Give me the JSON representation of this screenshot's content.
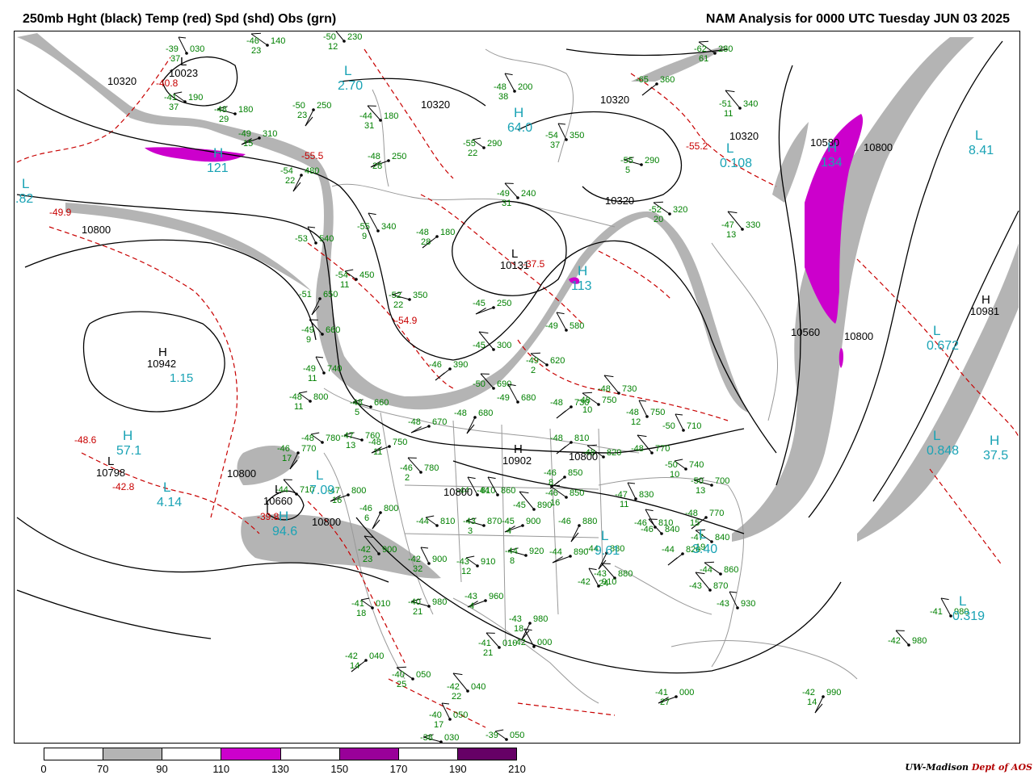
{
  "header": {
    "title_left": "250mb Hght (black) Temp (red) Spd (shd) Obs (grn)",
    "title_right": "NAM Analysis for 0000 UTC Tuesday  JUN 03 2025"
  },
  "legend": {
    "ticks": [
      "0",
      "70",
      "90",
      "110",
      "130",
      "150",
      "170",
      "190",
      "210"
    ],
    "bins": [
      {
        "range": "0-70",
        "color": "#ffffff"
      },
      {
        "range": "70-90",
        "color": "#b4b4b4"
      },
      {
        "range": "90-110",
        "color": "#ffffff"
      },
      {
        "range": "110-130",
        "color": "#cc00cc"
      },
      {
        "range": "130-150",
        "color": "#ffffff"
      },
      {
        "range": "150-170",
        "color": "#990099"
      },
      {
        "range": "170-190",
        "color": "#ffffff"
      },
      {
        "range": "190-210",
        "color": "#660066"
      }
    ]
  },
  "credit": {
    "org": "UW-Madison",
    "dept": "Dept of AOS"
  },
  "colors": {
    "height_contours": "#000000",
    "temperature_contours": "#c80000",
    "speed_shading_70_90": "#b4b4b4",
    "speed_shading_110_130": "#cc00cc",
    "observations": "#008000",
    "pressure_centers": "#1aa3b5",
    "borders": "#999999"
  },
  "height_centers": [
    {
      "type": "H",
      "value": "10942",
      "speed": "1.15"
    },
    {
      "type": "L",
      "value": "10131",
      "speed": ""
    },
    {
      "type": "H",
      "value": "10902",
      "speed": ""
    },
    {
      "type": "H",
      "value": "10981",
      "speed": ""
    },
    {
      "type": "L",
      "value": "10660",
      "speed": ""
    },
    {
      "type": "L",
      "value": "10798",
      "speed": ""
    },
    {
      "type": "L",
      "value": "10023",
      "speed": ""
    }
  ],
  "contour_labels": [
    "10320",
    "10320",
    "10320",
    "10320",
    "10320",
    "10800",
    "10800",
    "10800",
    "10800",
    "10800",
    "10800",
    "10560",
    "10580",
    "10800"
  ],
  "temperature_labels": [
    "-49.9",
    "-55.5",
    "-54.9",
    "-48.6",
    "-42.8",
    "-39.8",
    "-37.5",
    "-55.2",
    "-40.8"
  ],
  "speed_labels": [
    {
      "type": "L",
      "value": ".82"
    },
    {
      "type": "H",
      "value": "121"
    },
    {
      "type": "H",
      "value": "57.1"
    },
    {
      "type": "L",
      "value": "4.14"
    },
    {
      "type": "H",
      "value": "94.6"
    },
    {
      "type": "L",
      "value": "7.09"
    },
    {
      "type": "H",
      "value": "64.0"
    },
    {
      "type": "L",
      "value": "2.70"
    },
    {
      "type": "H",
      "value": "113"
    },
    {
      "type": "L",
      "value": "0.108"
    },
    {
      "type": "H",
      "value": "134"
    },
    {
      "type": "L",
      "value": "8.41"
    },
    {
      "type": "L",
      "value": "0.672"
    },
    {
      "type": "L",
      "value": "0.848"
    },
    {
      "type": "H",
      "value": "37.5"
    },
    {
      "type": "L",
      "value": "3.40"
    },
    {
      "type": "L",
      "value": "0.319"
    },
    {
      "type": "L",
      "value": "9.61"
    }
  ],
  "observations": [
    {
      "temp": "-46",
      "height": "140",
      "dew": "23"
    },
    {
      "temp": "-50",
      "height": "230",
      "dew": "12"
    },
    {
      "temp": "-39",
      "height": "030",
      "dew": "37"
    },
    {
      "temp": "-41",
      "height": "190",
      "dew": "37"
    },
    {
      "temp": "-48",
      "height": "180",
      "dew": "29"
    },
    {
      "temp": "-49",
      "height": "310",
      "dew": "15"
    },
    {
      "temp": "-50",
      "height": "250",
      "dew": "23"
    },
    {
      "temp": "-44",
      "height": "180",
      "dew": "31"
    },
    {
      "temp": "-48",
      "height": "200",
      "dew": "38"
    },
    {
      "temp": "-65",
      "height": "360",
      "dew": ""
    },
    {
      "temp": "-62",
      "height": "280",
      "dew": "61"
    },
    {
      "temp": "-51",
      "height": "340",
      "dew": "11"
    },
    {
      "temp": "-54",
      "height": "350",
      "dew": "37"
    },
    {
      "temp": "-55",
      "height": "290",
      "dew": "22"
    },
    {
      "temp": "-55",
      "height": "290",
      "dew": "5"
    },
    {
      "temp": "-48",
      "height": "250",
      "dew": "28"
    },
    {
      "temp": "-54",
      "height": "480",
      "dew": "22"
    },
    {
      "temp": "-49",
      "height": "240",
      "dew": "31"
    },
    {
      "temp": "-55",
      "height": "340",
      "dew": "9"
    },
    {
      "temp": "-48",
      "height": "180",
      "dew": "28"
    },
    {
      "temp": "-52",
      "height": "320",
      "dew": "20"
    },
    {
      "temp": "-47",
      "height": "330",
      "dew": "13"
    },
    {
      "temp": "-53",
      "height": "540",
      "dew": ""
    },
    {
      "temp": "-54",
      "height": "450",
      "dew": "11"
    },
    {
      "temp": "-52",
      "height": "350",
      "dew": "22"
    },
    {
      "temp": "-45",
      "height": "250",
      "dew": ""
    },
    {
      "temp": "-51",
      "height": "650",
      "dew": ""
    },
    {
      "temp": "-49",
      "height": "660",
      "dew": "9"
    },
    {
      "temp": "-49",
      "height": "580",
      "dew": ""
    },
    {
      "temp": "-46",
      "height": "390",
      "dew": ""
    },
    {
      "temp": "-49",
      "height": "620",
      "dew": "2"
    },
    {
      "temp": "-45",
      "height": "300",
      "dew": ""
    },
    {
      "temp": "-49",
      "height": "740",
      "dew": "11"
    },
    {
      "temp": "-48",
      "height": "800",
      "dew": "11"
    },
    {
      "temp": "-48",
      "height": "660",
      "dew": "5"
    },
    {
      "temp": "-48",
      "height": "670",
      "dew": ""
    },
    {
      "temp": "-48",
      "height": "680",
      "dew": ""
    },
    {
      "temp": "-50",
      "height": "690",
      "dew": ""
    },
    {
      "temp": "-49",
      "height": "680",
      "dew": ""
    },
    {
      "temp": "-48",
      "height": "730",
      "dew": ""
    },
    {
      "temp": "-48",
      "height": "750",
      "dew": "10"
    },
    {
      "temp": "-48",
      "height": "730",
      "dew": ""
    },
    {
      "temp": "-48",
      "height": "750",
      "dew": "12"
    },
    {
      "temp": "-48",
      "height": "780",
      "dew": ""
    },
    {
      "temp": "-47",
      "height": "760",
      "dew": "13"
    },
    {
      "temp": "-48",
      "height": "750",
      "dew": "11"
    },
    {
      "temp": "-46",
      "height": "770",
      "dew": "17"
    },
    {
      "temp": "-46",
      "height": "780",
      "dew": "2"
    },
    {
      "temp": "-44",
      "height": "810",
      "dew": ""
    },
    {
      "temp": "-48",
      "height": "810",
      "dew": ""
    },
    {
      "temp": "-48",
      "height": "820",
      "dew": ""
    },
    {
      "temp": "-48",
      "height": "770",
      "dew": ""
    },
    {
      "temp": "-50",
      "height": "710",
      "dew": ""
    },
    {
      "temp": "-50",
      "height": "740",
      "dew": "10"
    },
    {
      "temp": "-50",
      "height": "700",
      "dew": "13"
    },
    {
      "temp": "-47",
      "height": "800",
      "dew": "16"
    },
    {
      "temp": "-46",
      "height": "800",
      "dew": "6"
    },
    {
      "temp": "-44",
      "height": "710",
      "dew": ""
    },
    {
      "temp": "-44",
      "height": "860",
      "dew": ""
    },
    {
      "temp": "-46",
      "height": "850",
      "dew": "8"
    },
    {
      "temp": "-46",
      "height": "850",
      "dew": "16"
    },
    {
      "temp": "-45",
      "height": "890",
      "dew": ""
    },
    {
      "temp": "-47",
      "height": "830",
      "dew": "11"
    },
    {
      "temp": "-44",
      "height": "810",
      "dew": ""
    },
    {
      "temp": "-43",
      "height": "870",
      "dew": "3"
    },
    {
      "temp": "-45",
      "height": "900",
      "dew": "4"
    },
    {
      "temp": "-46",
      "height": "880",
      "dew": ""
    },
    {
      "temp": "-46",
      "height": "840",
      "dew": ""
    },
    {
      "temp": "-46",
      "height": "810",
      "dew": ""
    },
    {
      "temp": "-48",
      "height": "770",
      "dew": "15"
    },
    {
      "temp": "-47",
      "height": "840",
      "dew": "19"
    },
    {
      "temp": "-42",
      "height": "900",
      "dew": "23"
    },
    {
      "temp": "-42",
      "height": "900",
      "dew": "32"
    },
    {
      "temp": "-43",
      "height": "910",
      "dew": "12"
    },
    {
      "temp": "-44",
      "height": "920",
      "dew": "8"
    },
    {
      "temp": "-44",
      "height": "890",
      "dew": ""
    },
    {
      "temp": "-44",
      "height": "880",
      "dew": ""
    },
    {
      "temp": "-43",
      "height": "880",
      "dew": "24"
    },
    {
      "temp": "-42",
      "height": "910",
      "dew": ""
    },
    {
      "temp": "-44",
      "height": "820",
      "dew": ""
    },
    {
      "temp": "-44",
      "height": "860",
      "dew": ""
    },
    {
      "temp": "-43",
      "height": "870",
      "dew": ""
    },
    {
      "temp": "-43",
      "height": "930",
      "dew": ""
    },
    {
      "temp": "-41",
      "height": "010",
      "dew": "18"
    },
    {
      "temp": "-40",
      "height": "980",
      "dew": "21"
    },
    {
      "temp": "-43",
      "height": "960",
      "dew": "4"
    },
    {
      "temp": "-43",
      "height": "980",
      "dew": "18"
    },
    {
      "temp": "-41",
      "height": "010",
      "dew": "21"
    },
    {
      "temp": "-42",
      "height": "000",
      "dew": ""
    },
    {
      "temp": "-42",
      "height": "040",
      "dew": "14"
    },
    {
      "temp": "-40",
      "height": "050",
      "dew": "25"
    },
    {
      "temp": "-42",
      "height": "040",
      "dew": "22"
    },
    {
      "temp": "-40",
      "height": "050",
      "dew": "17"
    },
    {
      "temp": "-39",
      "height": "050",
      "dew": ""
    },
    {
      "temp": "-38",
      "height": "030",
      "dew": ""
    },
    {
      "temp": "-41",
      "height": "000",
      "dew": "27"
    },
    {
      "temp": "-42",
      "height": "990",
      "dew": "14"
    },
    {
      "temp": "-42",
      "height": "980",
      "dew": ""
    },
    {
      "temp": "-41",
      "height": "980",
      "dew": ""
    }
  ]
}
